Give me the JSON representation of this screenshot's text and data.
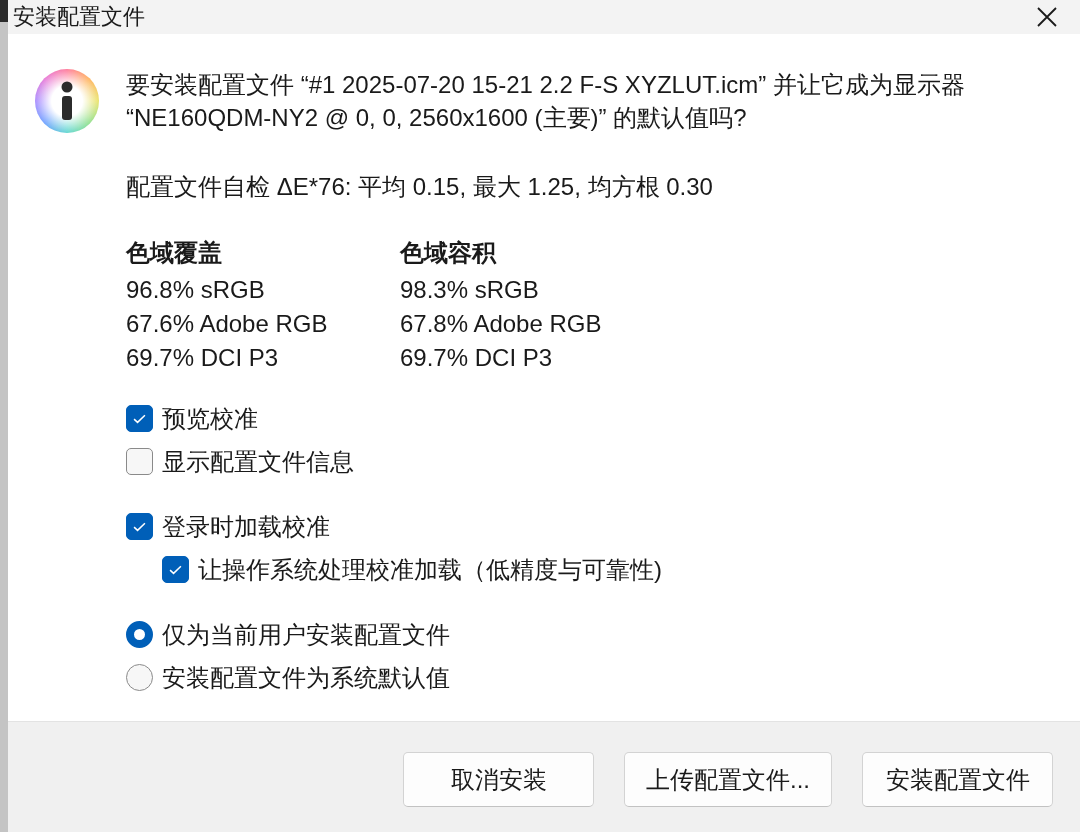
{
  "window": {
    "title": "安装配置文件"
  },
  "message": {
    "text": "要安装配置文件 “#1 2025-07-20 15-21 2.2 F-S XYZLUT.icm” 并让它成为显示器 “NE160QDM-NY2 @ 0, 0, 2560x1600 (主要)” 的默认值吗?"
  },
  "self_check": "配置文件自检 ΔE*76: 平均 0.15, 最大 1.25, 均方根 0.30",
  "gamut": {
    "columns": [
      {
        "heading": "色域覆盖",
        "values": [
          "96.8% sRGB",
          "67.6% Adobe RGB",
          "69.7% DCI P3"
        ]
      },
      {
        "heading": "色域容积",
        "values": [
          "98.3% sRGB",
          "67.8% Adobe RGB",
          "69.7% DCI P3"
        ]
      }
    ]
  },
  "options": {
    "groups": [
      {
        "items": [
          {
            "kind": "checkbox",
            "label": "预览校准",
            "checked": true
          },
          {
            "kind": "checkbox",
            "label": "显示配置文件信息",
            "checked": false
          }
        ]
      },
      {
        "items": [
          {
            "kind": "checkbox",
            "label": "登录时加载校准",
            "checked": true,
            "children": [
              {
                "kind": "checkbox",
                "label": "让操作系统处理校准加载（低精度与可靠性)",
                "checked": true
              }
            ]
          }
        ]
      },
      {
        "items": [
          {
            "kind": "radio",
            "label": "仅为当前用户安装配置文件",
            "selected": true
          },
          {
            "kind": "radio",
            "label": "安装配置文件为系统默认值",
            "selected": false
          }
        ]
      }
    ]
  },
  "buttons": [
    {
      "label": "取消安装"
    },
    {
      "label": "上传配置文件..."
    },
    {
      "label": "安装配置文件"
    }
  ]
}
